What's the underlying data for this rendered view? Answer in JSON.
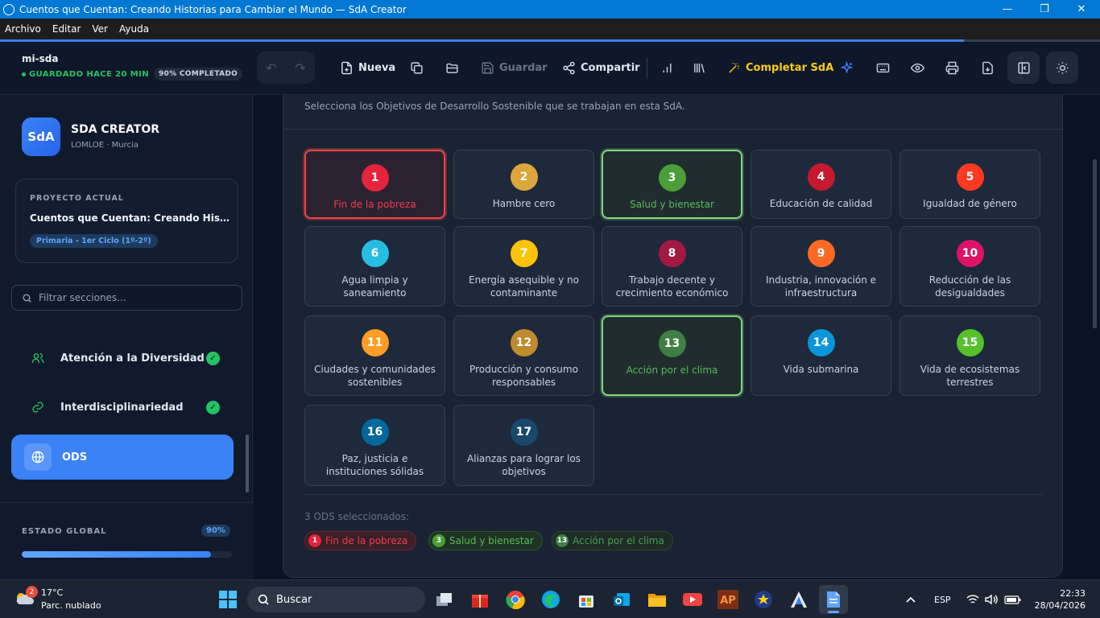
{
  "window": {
    "title": "Cuentos que Cuentan: Creando Historias para Cambiar el Mundo  — SdA Creator",
    "controls": {
      "minimize": "—",
      "maximize": "❐",
      "close": "✕"
    }
  },
  "menu": [
    "Archivo",
    "Editar",
    "Ver",
    "Ayuda"
  ],
  "toolbar": {
    "project_slug": "mi-sda",
    "saved_status": "GUARDADO HACE 20 MIN",
    "completion_badge": "90% COMPLETADO",
    "new_label": "Nueva",
    "save_label": "Guardar",
    "share_label": "Compartir",
    "complete_label": "Completar SdA"
  },
  "sidebar": {
    "logo_text": "SdA",
    "brand": "SDA CREATOR",
    "brand_sub": "LOMLOE · Murcia",
    "project_label": "PROYECTO ACTUAL",
    "project_name": "Cuentos que Cuentan: Creando Historias para Cambiar el Mundo",
    "project_level": "Primaria - 1er Ciclo (1º-2º)",
    "filter_placeholder": "Filtrar secciones...",
    "nav_items": [
      {
        "label": "Atención a la Diversidad",
        "icon": "users-icon",
        "done": true,
        "active": false
      },
      {
        "label": "Interdisciplinariedad",
        "icon": "link-icon",
        "done": true,
        "active": false
      },
      {
        "label": "ODS",
        "icon": "globe-icon",
        "done": false,
        "active": true
      }
    ],
    "global_label": "ESTADO GLOBAL",
    "global_pct": "90%",
    "global_progress": 0.9
  },
  "main": {
    "intro": "Selecciona los Objetivos de Desarrollo Sostenible que se trabajan en esta SdA.",
    "ods": [
      {
        "num": "1",
        "name": "Fin de la pobreza",
        "color": "#e5243b",
        "selected": true
      },
      {
        "num": "2",
        "name": "Hambre cero",
        "color": "#dda63a",
        "selected": false
      },
      {
        "num": "3",
        "name": "Salud y bienestar",
        "color": "#4c9f38",
        "selected": true
      },
      {
        "num": "4",
        "name": "Educación de calidad",
        "color": "#c5192d",
        "selected": false
      },
      {
        "num": "5",
        "name": "Igualdad de género",
        "color": "#ff3a21",
        "selected": false
      },
      {
        "num": "6",
        "name": "Agua limpia y saneamiento",
        "color": "#26bde2",
        "selected": false
      },
      {
        "num": "7",
        "name": "Energía asequible y no contaminante",
        "color": "#fcc30b",
        "selected": false
      },
      {
        "num": "8",
        "name": "Trabajo decente y crecimiento económico",
        "color": "#a21942",
        "selected": false
      },
      {
        "num": "9",
        "name": "Industria, innovación e infraestructura",
        "color": "#fd6925",
        "selected": false
      },
      {
        "num": "10",
        "name": "Reducción de las desigualdades",
        "color": "#dd1367",
        "selected": false
      },
      {
        "num": "11",
        "name": "Ciudades y comunidades sostenibles",
        "color": "#fd9d24",
        "selected": false
      },
      {
        "num": "12",
        "name": "Producción y consumo responsables",
        "color": "#bf8b2e",
        "selected": false
      },
      {
        "num": "13",
        "name": "Acción por el clima",
        "color": "#3f7e44",
        "selected": true
      },
      {
        "num": "14",
        "name": "Vida submarina",
        "color": "#0a97d9",
        "selected": false
      },
      {
        "num": "15",
        "name": "Vida de ecosistemas terrestres",
        "color": "#56c02b",
        "selected": false
      },
      {
        "num": "16",
        "name": "Paz, justicia e instituciones sólidas",
        "color": "#00689d",
        "selected": false
      },
      {
        "num": "17",
        "name": "Alianzas para lograr los objetivos",
        "color": "#19486a",
        "selected": false
      }
    ],
    "selected_count": "3 ODS seleccionados:",
    "chips": [
      {
        "num": "1",
        "name": "Fin de la pobreza",
        "color": "#e5243b",
        "text": "#f03c4a",
        "bg": "#3a1f29"
      },
      {
        "num": "3",
        "name": "Salud y bienestar",
        "color": "#4c9f38",
        "text": "#5cb85c",
        "bg": "#1f3324"
      },
      {
        "num": "13",
        "name": "Acción por el clima",
        "color": "#3f7e44",
        "text": "#4f9a55",
        "bg": "#1d2d26"
      }
    ]
  },
  "taskbar": {
    "weather_badge": "2",
    "temp": "17°C",
    "condition": "Parc. nublado",
    "search": "Buscar",
    "lang": "ESP",
    "time": "22:33",
    "date": "28/04/2026"
  }
}
